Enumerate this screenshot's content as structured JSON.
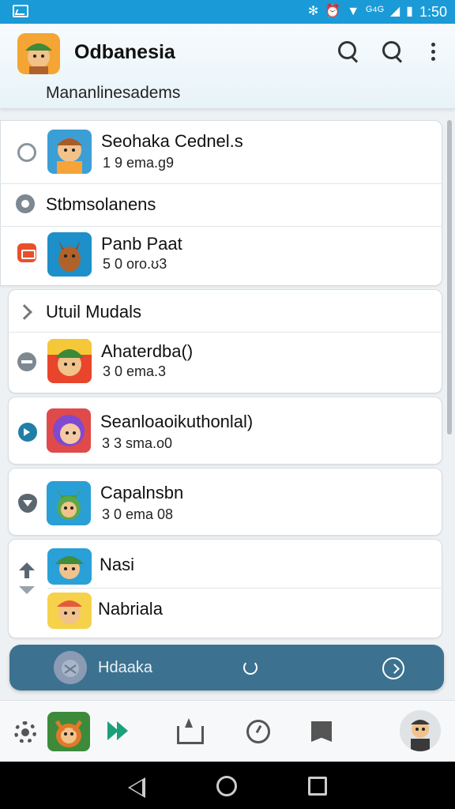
{
  "status_bar": {
    "time": "1:50",
    "signal_text": "ᴳ⁴ᴳ"
  },
  "app_bar": {
    "title": "Odbanesia",
    "subtitle": "Mananlinesadems"
  },
  "list": [
    {
      "type": "item",
      "title": "Seohaka Cednel.s",
      "subtitle": "1 9 ema.g9",
      "lead_icon": "ring-icon",
      "avatar_colors": [
        "#3b9fd6",
        "#f6a33a"
      ]
    },
    {
      "type": "header",
      "title": "Stbmsolanens",
      "lead_icon": "gear-badge-icon"
    },
    {
      "type": "item",
      "title": "Panb Paat",
      "subtitle": "5 0 oro.ʊ3",
      "lead_icon": "red-badge-icon",
      "avatar_colors": [
        "#1d8fc9",
        "#b0622b"
      ]
    },
    {
      "type": "header",
      "title": "Utuil Mudals",
      "lead_icon": "chevron-right-icon"
    },
    {
      "type": "item",
      "title": "Ahaterdba()",
      "subtitle": "3 0 ema.3",
      "lead_icon": "minus-icon",
      "avatar_colors": [
        "#e8452c",
        "#3b8a3a"
      ]
    },
    {
      "type": "item",
      "title": "Seanloaoikuthonlal)",
      "subtitle": "3 3 sma.o0",
      "lead_icon": "play-badge-icon",
      "avatar_colors": [
        "#e04a4a",
        "#7f4ad0"
      ]
    },
    {
      "type": "item",
      "title": "Capalnsbn",
      "subtitle": "3 0 ema 08",
      "lead_icon": "shield-icon",
      "avatar_colors": [
        "#2a9fd6",
        "#4c9a3a"
      ]
    },
    {
      "type": "item",
      "title": "Nasi",
      "subtitle": "",
      "lead_icon": "arrow-up-icon",
      "avatar_colors": [
        "#2aa0d8",
        "#3f8c3a"
      ]
    },
    {
      "type": "item",
      "title": "Nabriala",
      "subtitle": "",
      "lead_icon": "arrow-down-icon",
      "avatar_colors": [
        "#f5d24a",
        "#e45b3a"
      ]
    }
  ],
  "player": {
    "title": "Hdaaka"
  },
  "colors": {
    "status_bar": "#1a9ad6",
    "player": "#3c7290",
    "accent_green": "#1aa07a"
  }
}
